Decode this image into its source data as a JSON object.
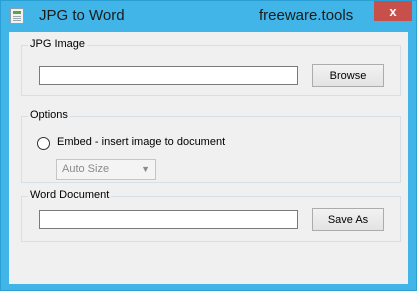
{
  "window": {
    "title": "JPG to Word",
    "brand": "freeware.tools",
    "close_glyph": "x"
  },
  "jpg_group": {
    "legend": "JPG Image",
    "input_value": "",
    "browse_label": "Browse"
  },
  "options_group": {
    "legend": "Options",
    "embed_label": "Embed - insert image to document",
    "embed_checked": false,
    "size_selected": "Auto Size",
    "size_enabled": false
  },
  "word_group": {
    "legend": "Word Document",
    "input_value": "",
    "save_label": "Save As"
  },
  "colors": {
    "titlebar": "#41b5e8",
    "close": "#c7504a",
    "client": "#f0f0f0"
  },
  "icons": {
    "app": "document-icon",
    "close": "close-icon",
    "dropdown": "chevron-down-icon"
  }
}
